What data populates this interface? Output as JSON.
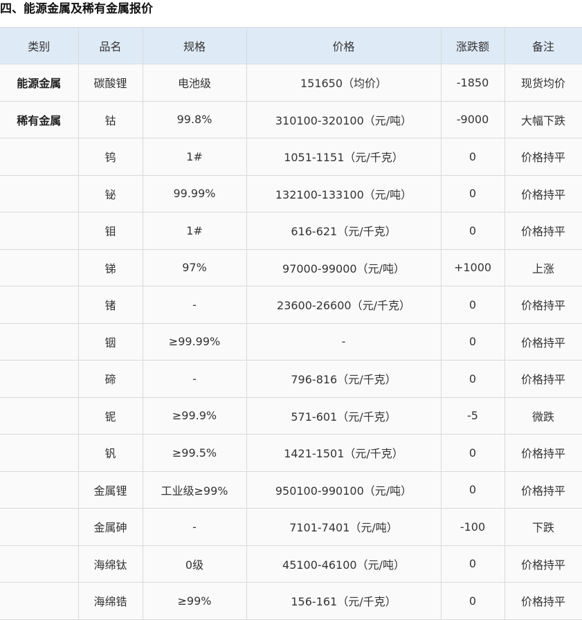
{
  "section_title": "四、能源金属及稀有金属报价",
  "table": {
    "headers": [
      "类别",
      "品名",
      "规格",
      "价格",
      "涨跌额",
      "备注"
    ],
    "rows": [
      [
        "能源金属",
        "碳酸锂",
        "电池级",
        "151650（均价）",
        "-1850",
        "现货均价"
      ],
      [
        "稀有金属",
        "钴",
        "99.8%",
        "310100-320100（元/吨）",
        "-9000",
        "大幅下跌"
      ],
      [
        "",
        "钨",
        "1#",
        "1051-1151（元/千克）",
        "0",
        "价格持平"
      ],
      [
        "",
        "铋",
        "99.99%",
        "132100-133100（元/吨）",
        "0",
        "价格持平"
      ],
      [
        "",
        "钼",
        "1#",
        "616-621（元/千克）",
        "0",
        "价格持平"
      ],
      [
        "",
        "锑",
        "97%",
        "97000-99000（元/吨）",
        "+1000",
        "上涨"
      ],
      [
        "",
        "锗",
        "-",
        "23600-26600（元/千克）",
        "0",
        "价格持平"
      ],
      [
        "",
        "铟",
        "≥99.99%",
        "-",
        "0",
        "价格持平"
      ],
      [
        "",
        "碲",
        "-",
        "796-816（元/千克）",
        "0",
        "价格持平"
      ],
      [
        "",
        "铌",
        "≥99.9%",
        "571-601（元/千克）",
        "-5",
        "微跌"
      ],
      [
        "",
        "钒",
        "≥99.5%",
        "1421-1501（元/千克）",
        "0",
        "价格持平"
      ],
      [
        "",
        "金属锂",
        "工业级≥99%",
        "950100-990100（元/吨）",
        "0",
        "价格持平"
      ],
      [
        "",
        "金属砷",
        "-",
        "7101-7401（元/吨）",
        "-100",
        "下跌"
      ],
      [
        "",
        "海绵钛",
        "0级",
        "45100-46100（元/吨）",
        "0",
        "价格持平"
      ],
      [
        "",
        "海绵锆",
        "≥99%",
        "156-161（元/千克）",
        "0",
        "价格持平"
      ]
    ]
  }
}
